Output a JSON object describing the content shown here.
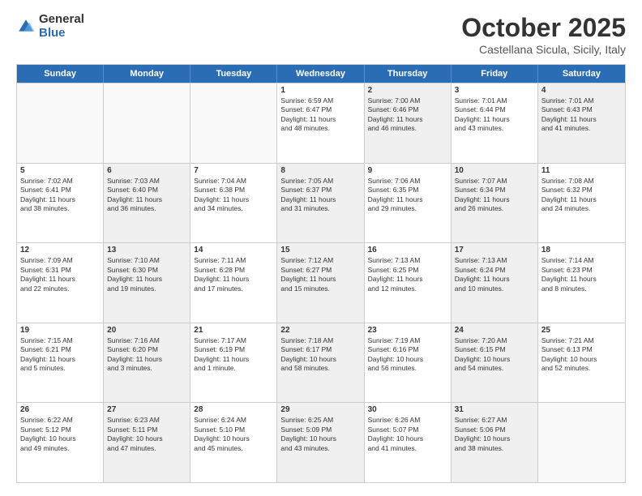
{
  "header": {
    "logo_general": "General",
    "logo_blue": "Blue",
    "month_title": "October 2025",
    "location": "Castellana Sicula, Sicily, Italy"
  },
  "days_of_week": [
    "Sunday",
    "Monday",
    "Tuesday",
    "Wednesday",
    "Thursday",
    "Friday",
    "Saturday"
  ],
  "weeks": [
    [
      {
        "day": "",
        "info": "",
        "shaded": false,
        "empty": true
      },
      {
        "day": "",
        "info": "",
        "shaded": false,
        "empty": true
      },
      {
        "day": "",
        "info": "",
        "shaded": false,
        "empty": true
      },
      {
        "day": "1",
        "info": "Sunrise: 6:59 AM\nSunset: 6:47 PM\nDaylight: 11 hours\nand 48 minutes.",
        "shaded": false,
        "empty": false
      },
      {
        "day": "2",
        "info": "Sunrise: 7:00 AM\nSunset: 6:46 PM\nDaylight: 11 hours\nand 46 minutes.",
        "shaded": true,
        "empty": false
      },
      {
        "day": "3",
        "info": "Sunrise: 7:01 AM\nSunset: 6:44 PM\nDaylight: 11 hours\nand 43 minutes.",
        "shaded": false,
        "empty": false
      },
      {
        "day": "4",
        "info": "Sunrise: 7:01 AM\nSunset: 6:43 PM\nDaylight: 11 hours\nand 41 minutes.",
        "shaded": true,
        "empty": false
      }
    ],
    [
      {
        "day": "5",
        "info": "Sunrise: 7:02 AM\nSunset: 6:41 PM\nDaylight: 11 hours\nand 38 minutes.",
        "shaded": false,
        "empty": false
      },
      {
        "day": "6",
        "info": "Sunrise: 7:03 AM\nSunset: 6:40 PM\nDaylight: 11 hours\nand 36 minutes.",
        "shaded": true,
        "empty": false
      },
      {
        "day": "7",
        "info": "Sunrise: 7:04 AM\nSunset: 6:38 PM\nDaylight: 11 hours\nand 34 minutes.",
        "shaded": false,
        "empty": false
      },
      {
        "day": "8",
        "info": "Sunrise: 7:05 AM\nSunset: 6:37 PM\nDaylight: 11 hours\nand 31 minutes.",
        "shaded": true,
        "empty": false
      },
      {
        "day": "9",
        "info": "Sunrise: 7:06 AM\nSunset: 6:35 PM\nDaylight: 11 hours\nand 29 minutes.",
        "shaded": false,
        "empty": false
      },
      {
        "day": "10",
        "info": "Sunrise: 7:07 AM\nSunset: 6:34 PM\nDaylight: 11 hours\nand 26 minutes.",
        "shaded": true,
        "empty": false
      },
      {
        "day": "11",
        "info": "Sunrise: 7:08 AM\nSunset: 6:32 PM\nDaylight: 11 hours\nand 24 minutes.",
        "shaded": false,
        "empty": false
      }
    ],
    [
      {
        "day": "12",
        "info": "Sunrise: 7:09 AM\nSunset: 6:31 PM\nDaylight: 11 hours\nand 22 minutes.",
        "shaded": false,
        "empty": false
      },
      {
        "day": "13",
        "info": "Sunrise: 7:10 AM\nSunset: 6:30 PM\nDaylight: 11 hours\nand 19 minutes.",
        "shaded": true,
        "empty": false
      },
      {
        "day": "14",
        "info": "Sunrise: 7:11 AM\nSunset: 6:28 PM\nDaylight: 11 hours\nand 17 minutes.",
        "shaded": false,
        "empty": false
      },
      {
        "day": "15",
        "info": "Sunrise: 7:12 AM\nSunset: 6:27 PM\nDaylight: 11 hours\nand 15 minutes.",
        "shaded": true,
        "empty": false
      },
      {
        "day": "16",
        "info": "Sunrise: 7:13 AM\nSunset: 6:25 PM\nDaylight: 11 hours\nand 12 minutes.",
        "shaded": false,
        "empty": false
      },
      {
        "day": "17",
        "info": "Sunrise: 7:13 AM\nSunset: 6:24 PM\nDaylight: 11 hours\nand 10 minutes.",
        "shaded": true,
        "empty": false
      },
      {
        "day": "18",
        "info": "Sunrise: 7:14 AM\nSunset: 6:23 PM\nDaylight: 11 hours\nand 8 minutes.",
        "shaded": false,
        "empty": false
      }
    ],
    [
      {
        "day": "19",
        "info": "Sunrise: 7:15 AM\nSunset: 6:21 PM\nDaylight: 11 hours\nand 5 minutes.",
        "shaded": false,
        "empty": false
      },
      {
        "day": "20",
        "info": "Sunrise: 7:16 AM\nSunset: 6:20 PM\nDaylight: 11 hours\nand 3 minutes.",
        "shaded": true,
        "empty": false
      },
      {
        "day": "21",
        "info": "Sunrise: 7:17 AM\nSunset: 6:19 PM\nDaylight: 11 hours\nand 1 minute.",
        "shaded": false,
        "empty": false
      },
      {
        "day": "22",
        "info": "Sunrise: 7:18 AM\nSunset: 6:17 PM\nDaylight: 10 hours\nand 58 minutes.",
        "shaded": true,
        "empty": false
      },
      {
        "day": "23",
        "info": "Sunrise: 7:19 AM\nSunset: 6:16 PM\nDaylight: 10 hours\nand 56 minutes.",
        "shaded": false,
        "empty": false
      },
      {
        "day": "24",
        "info": "Sunrise: 7:20 AM\nSunset: 6:15 PM\nDaylight: 10 hours\nand 54 minutes.",
        "shaded": true,
        "empty": false
      },
      {
        "day": "25",
        "info": "Sunrise: 7:21 AM\nSunset: 6:13 PM\nDaylight: 10 hours\nand 52 minutes.",
        "shaded": false,
        "empty": false
      }
    ],
    [
      {
        "day": "26",
        "info": "Sunrise: 6:22 AM\nSunset: 5:12 PM\nDaylight: 10 hours\nand 49 minutes.",
        "shaded": false,
        "empty": false
      },
      {
        "day": "27",
        "info": "Sunrise: 6:23 AM\nSunset: 5:11 PM\nDaylight: 10 hours\nand 47 minutes.",
        "shaded": true,
        "empty": false
      },
      {
        "day": "28",
        "info": "Sunrise: 6:24 AM\nSunset: 5:10 PM\nDaylight: 10 hours\nand 45 minutes.",
        "shaded": false,
        "empty": false
      },
      {
        "day": "29",
        "info": "Sunrise: 6:25 AM\nSunset: 5:09 PM\nDaylight: 10 hours\nand 43 minutes.",
        "shaded": true,
        "empty": false
      },
      {
        "day": "30",
        "info": "Sunrise: 6:26 AM\nSunset: 5:07 PM\nDaylight: 10 hours\nand 41 minutes.",
        "shaded": false,
        "empty": false
      },
      {
        "day": "31",
        "info": "Sunrise: 6:27 AM\nSunset: 5:06 PM\nDaylight: 10 hours\nand 38 minutes.",
        "shaded": true,
        "empty": false
      },
      {
        "day": "",
        "info": "",
        "shaded": false,
        "empty": true
      }
    ]
  ]
}
